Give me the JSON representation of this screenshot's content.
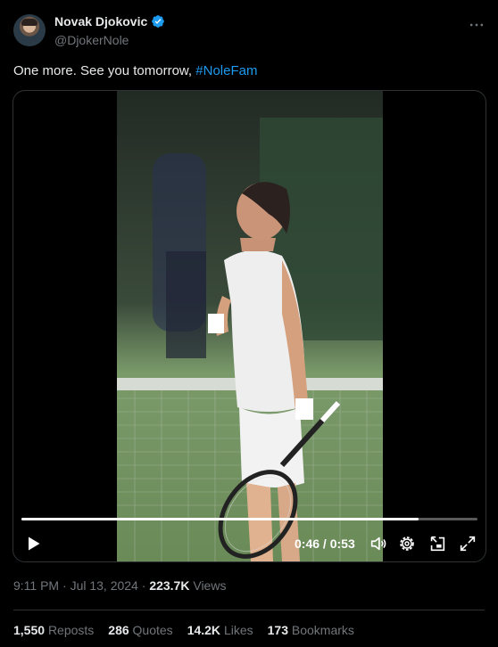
{
  "author": {
    "name": "Novak Djokovic",
    "handle": "@DjokerNole",
    "avatar_icon": "avatar-photo",
    "verified_icon": "verified-badge-icon",
    "verified_color": "#1d9bf0"
  },
  "tweet": {
    "text": "One more. See you tomorrow, ",
    "hashtag": "#NoleFam"
  },
  "video": {
    "current_time": "0:46",
    "separator": " / ",
    "duration": "0:53",
    "progress": 0.87,
    "controls": [
      "play-icon",
      "volume-icon",
      "settings-icon",
      "picture-in-picture-icon",
      "fullscreen-icon"
    ]
  },
  "meta": {
    "time": "9:11 PM",
    "dot": " · ",
    "date": "Jul 13, 2024",
    "views_count": "223.7K",
    "views_label": " Views"
  },
  "stats": [
    {
      "count": "1,550",
      "label": "Reposts"
    },
    {
      "count": "286",
      "label": "Quotes"
    },
    {
      "count": "14.2K",
      "label": "Likes"
    },
    {
      "count": "173",
      "label": "Bookmarks"
    }
  ],
  "colors": {
    "background": "#000000",
    "text": "#e7e9ea",
    "muted": "#71767b",
    "accent": "#1d9bf0",
    "border": "#2f3336"
  }
}
